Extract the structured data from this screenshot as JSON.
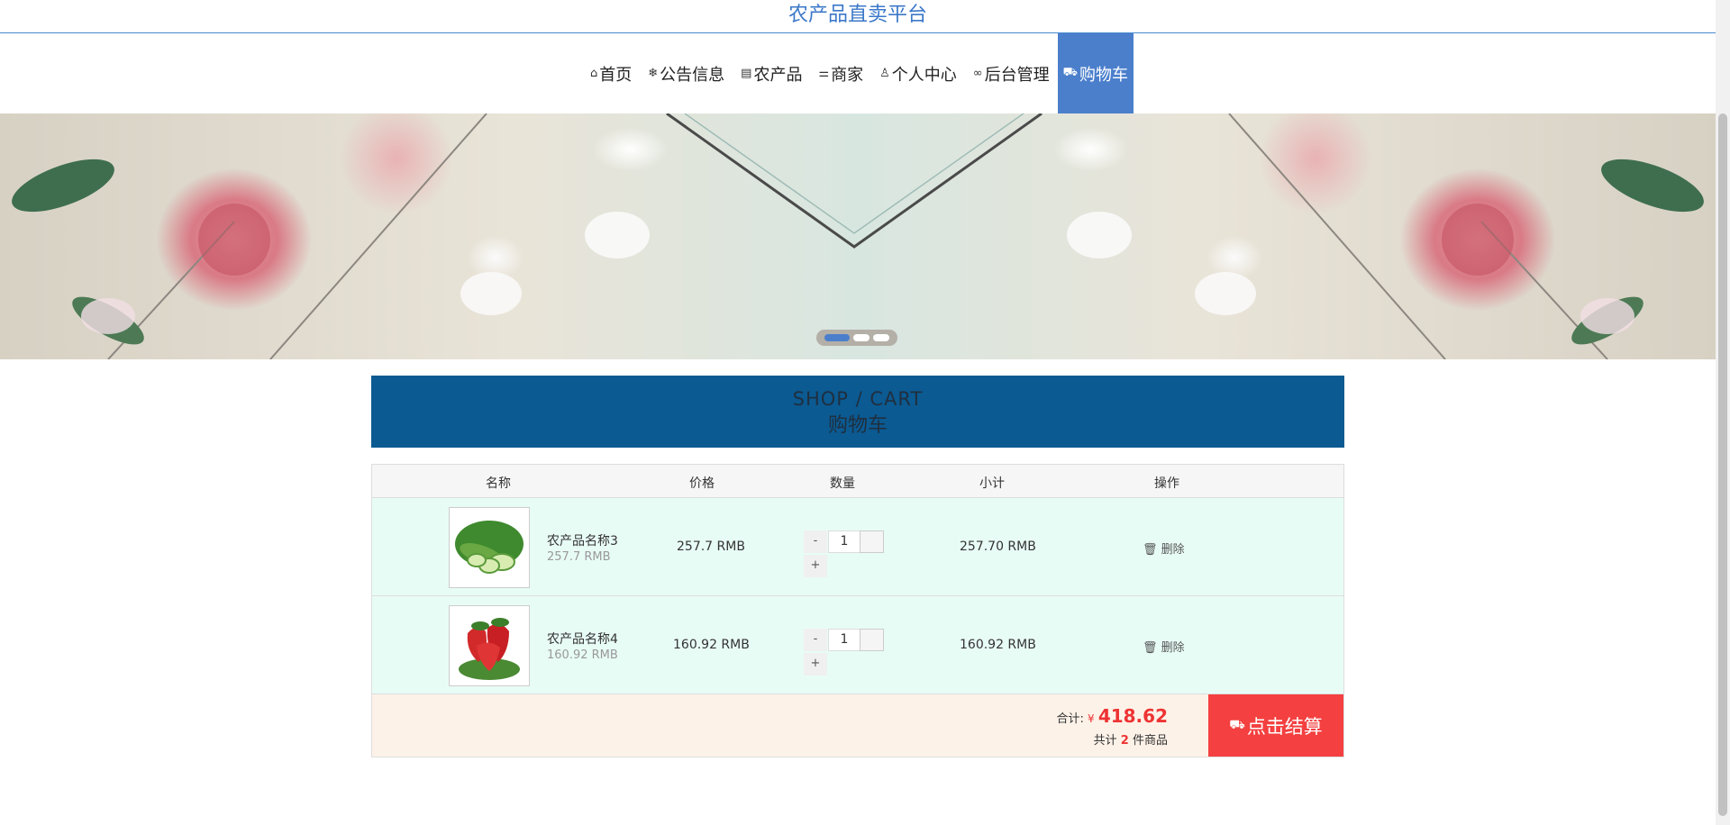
{
  "site": {
    "title": "农产品直卖平台"
  },
  "nav": {
    "items": [
      {
        "label": "首页",
        "icon": "home-icon",
        "glyph": "⌂"
      },
      {
        "label": "公告信息",
        "icon": "snowflake-icon",
        "glyph": "❄"
      },
      {
        "label": "农产品",
        "icon": "calendar-icon",
        "glyph": "▤"
      },
      {
        "label": "商家",
        "icon": "sliders-icon",
        "glyph": "⚌"
      },
      {
        "label": "个人中心",
        "icon": "user-icon",
        "glyph": "♙"
      },
      {
        "label": "后台管理",
        "icon": "link-icon",
        "glyph": "∞"
      },
      {
        "label": "购物车",
        "icon": "cart-icon",
        "glyph": "⛟",
        "active": true
      }
    ]
  },
  "banner": {
    "slides": 3,
    "active_slide": 1
  },
  "cart": {
    "title_en": "SHOP / CART",
    "title_zh": "购物车",
    "columns": {
      "name": "名称",
      "price": "价格",
      "quantity": "数量",
      "subtotal": "小计",
      "action": "操作"
    },
    "items": [
      {
        "name": "农产品名称3",
        "price_sub": "257.7 RMB",
        "price": "257.7 RMB",
        "quantity": "1",
        "minus": "-",
        "plus": "+",
        "subtotal": "257.70 RMB",
        "delete_label": "删除",
        "image": "cucumber-image"
      },
      {
        "name": "农产品名称4",
        "price_sub": "160.92 RMB",
        "price": "160.92 RMB",
        "quantity": "1",
        "minus": "-",
        "plus": "+",
        "subtotal": "160.92 RMB",
        "delete_label": "删除",
        "image": "strawberry-image"
      }
    ],
    "footer": {
      "total_label": "合计:",
      "currency": "¥",
      "total": "418.62",
      "count_prefix": "共计",
      "count": "2",
      "count_suffix": "件商品",
      "checkout_label": "点击结算"
    }
  },
  "colors": {
    "accent": "#4b7fcc",
    "header_bg": "#0b5a92",
    "checkout": "#f44040",
    "row_bg": "#e8fcf6",
    "footer_bg": "#fdf2e8"
  }
}
